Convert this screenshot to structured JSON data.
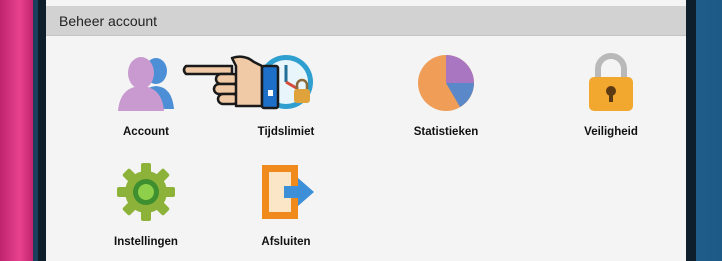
{
  "window": {
    "title": "Beheer account"
  },
  "tiles": [
    {
      "label": "Account",
      "icon": "account-icon"
    },
    {
      "label": "Tijdslimiet",
      "icon": "time-limit-icon"
    },
    {
      "label": "Statistieken",
      "icon": "statistics-pie-icon"
    },
    {
      "label": "Veiligheid",
      "icon": "padlock-icon"
    },
    {
      "label": "Instellingen",
      "icon": "gear-icon"
    },
    {
      "label": "Afsluiten",
      "icon": "exit-door-icon"
    }
  ],
  "cursor": {
    "icon": "pointing-hand-icon"
  },
  "colors": {
    "titlebar": "#d2d2d2",
    "screen": "#f4f4f4",
    "bezel": "#1d5a87",
    "case_accent": "#e8428e"
  }
}
